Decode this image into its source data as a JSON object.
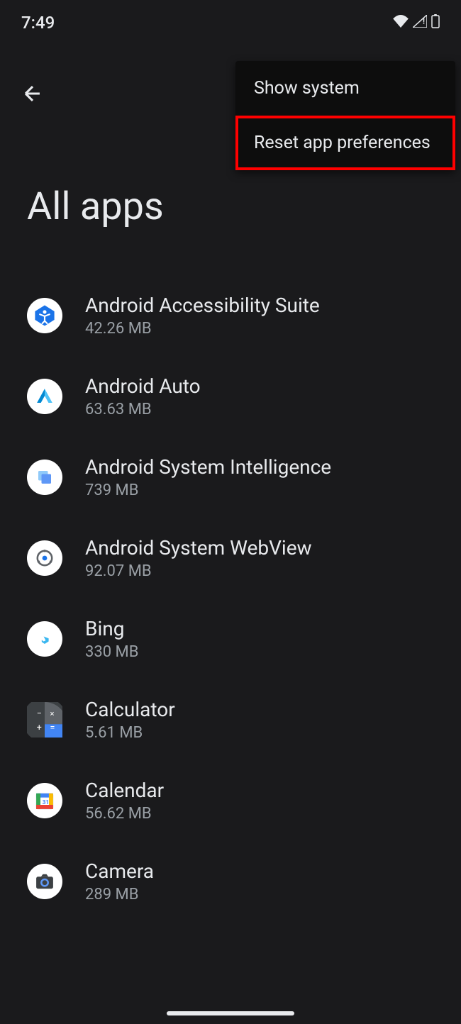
{
  "status": {
    "time": "7:49"
  },
  "page": {
    "title": "All apps"
  },
  "menu": {
    "items": [
      {
        "label": "Show system"
      },
      {
        "label": "Reset app preferences"
      }
    ]
  },
  "apps": [
    {
      "name": "Android Accessibility Suite",
      "size": "42.26 MB",
      "icon": "accessibility-icon"
    },
    {
      "name": "Android Auto",
      "size": "63.63 MB",
      "icon": "android-auto-icon"
    },
    {
      "name": "Android System Intelligence",
      "size": "739 MB",
      "icon": "asi-icon"
    },
    {
      "name": "Android System WebView",
      "size": "92.07 MB",
      "icon": "webview-icon"
    },
    {
      "name": "Bing",
      "size": "330 MB",
      "icon": "bing-icon"
    },
    {
      "name": "Calculator",
      "size": "5.61 MB",
      "icon": "calculator-icon"
    },
    {
      "name": "Calendar",
      "size": "56.62 MB",
      "icon": "calendar-icon"
    },
    {
      "name": "Camera",
      "size": "289 MB",
      "icon": "camera-icon"
    }
  ]
}
